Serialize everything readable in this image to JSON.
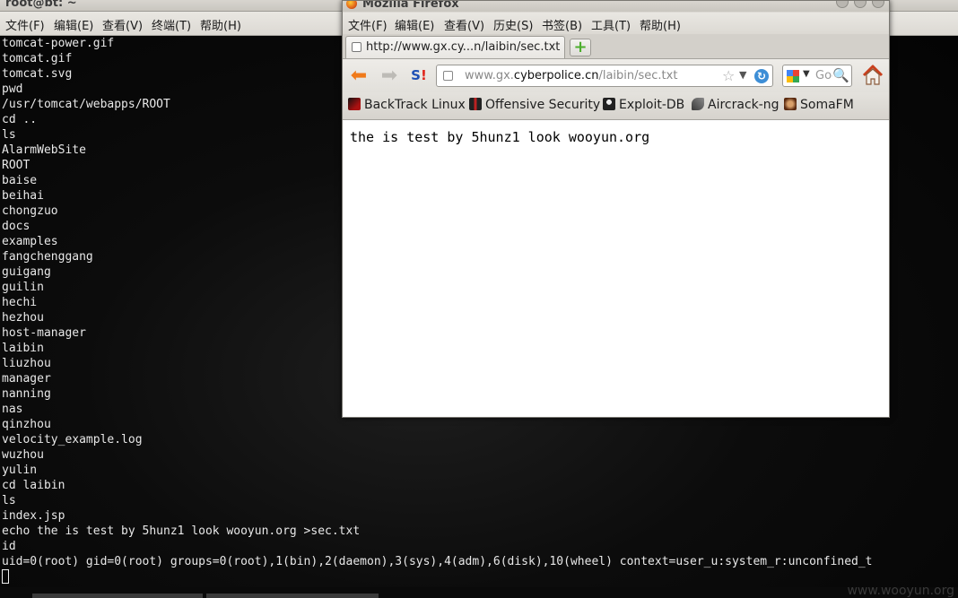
{
  "terminal": {
    "title": "root@bt: ~",
    "menu": [
      "文件(F)",
      "编辑(E)",
      "查看(V)",
      "终端(T)",
      "帮助(H)"
    ],
    "lines": [
      "tomcat-power.gif",
      "tomcat.gif",
      "tomcat.svg",
      "pwd",
      "/usr/tomcat/webapps/ROOT",
      "cd ..",
      "ls",
      "AlarmWebSite",
      "ROOT",
      "baise",
      "beihai",
      "chongzuo",
      "docs",
      "examples",
      "fangchenggang",
      "guigang",
      "guilin",
      "hechi",
      "hezhou",
      "host-manager",
      "laibin",
      "liuzhou",
      "manager",
      "nanning",
      "nas",
      "qinzhou",
      "velocity_example.log",
      "wuzhou",
      "yulin",
      "cd laibin",
      "ls",
      "index.jsp",
      "echo the is test by 5hunz1 look wooyun.org >sec.txt",
      "id",
      "uid=0(root) gid=0(root) groups=0(root),1(bin),2(daemon),3(sys),4(adm),6(disk),10(wheel) context=user_u:system_r:unconfined_t"
    ]
  },
  "desktop": {
    "watermark": "www.wooyun.org"
  },
  "firefox": {
    "title": "Mozilla Firefox",
    "menu": [
      "文件(F)",
      "编辑(E)",
      "查看(V)",
      "历史(S)",
      "书签(B)",
      "工具(T)",
      "帮助(H)"
    ],
    "tab_title": "http://www.gx.cy...n/laibin/sec.txt",
    "url": {
      "prefix": "www.gx.",
      "host": "cyberpolice.cn",
      "path": "/laibin/sec.txt"
    },
    "search_placeholder": "Goo",
    "bookmarks": [
      "BackTrack Linux",
      "Offensive Security",
      "Exploit-DB",
      "Aircrack-ng",
      "SomaFM"
    ],
    "page_text": "the is test by 5hunz1 look wooyun.org"
  },
  "colors": {
    "terminal_bg": "#050505",
    "terminal_text": "#e8e8e8",
    "back_arrow": "#f07a1a",
    "reload": "#3d8ed6"
  }
}
